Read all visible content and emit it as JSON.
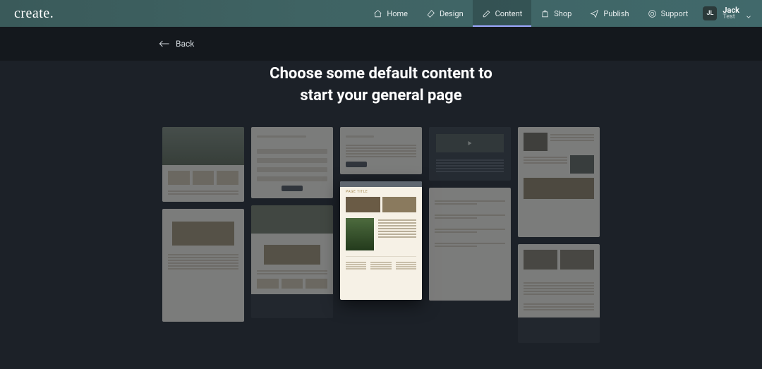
{
  "brand": "create.",
  "nav": {
    "home": "Home",
    "design": "Design",
    "content": "Content",
    "shop": "Shop",
    "publish": "Publish",
    "support": "Support"
  },
  "user": {
    "initials": "JL",
    "name": "Jack",
    "subtitle": "Test"
  },
  "back_label": "Back",
  "headline_line1": "Choose some default content to",
  "headline_line2": "start your general page",
  "templates": {
    "selected_heading": "PAGE TITLE"
  }
}
